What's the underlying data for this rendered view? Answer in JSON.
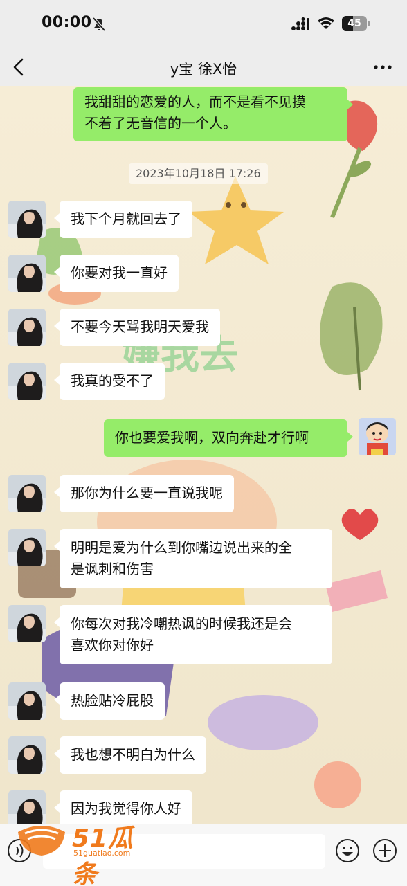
{
  "status_bar": {
    "time": "00:00",
    "battery": "45",
    "battery_level": 0.45
  },
  "header": {
    "title": "y宝 徐X怡"
  },
  "wallpaper": {
    "text": "嫌我去"
  },
  "messages": [
    {
      "side": "out",
      "lines": [
        "我甜甜的恋爱的人，而不是看不见摸",
        "不着了无音信的一个人。"
      ]
    },
    {
      "side": "in",
      "lines": [
        "我下个月就回去了"
      ]
    },
    {
      "side": "in",
      "lines": [
        "你要对我一直好"
      ]
    },
    {
      "side": "in",
      "lines": [
        "不要今天骂我明天爱我"
      ]
    },
    {
      "side": "in",
      "lines": [
        "我真的受不了"
      ]
    },
    {
      "side": "out",
      "lines": [
        "你也要爱我啊，双向奔赴才行啊"
      ]
    },
    {
      "side": "in",
      "lines": [
        "那你为什么要一直说我呢"
      ]
    },
    {
      "side": "in",
      "lines": [
        "明明是爱为什么到你嘴边说出来的全",
        "是讽刺和伤害"
      ]
    },
    {
      "side": "in",
      "lines": [
        "你每次对我冷嘲热讽的时候我还是会",
        "喜欢你对你好"
      ]
    },
    {
      "side": "in",
      "lines": [
        "热脸贴冷屁股"
      ]
    },
    {
      "side": "in",
      "lines": [
        "我也想不明白为什么"
      ]
    },
    {
      "side": "in",
      "lines": [
        "因为我觉得你人好"
      ]
    }
  ],
  "timestamp": "2023年10月18日 17:26",
  "watermark": {
    "brand": "51瓜条",
    "url": "51guatiao.com"
  },
  "icons": [
    "mute-icon",
    "signal-icon",
    "wifi-icon",
    "back-icon",
    "more-icon",
    "voice-icon",
    "emoji-icon",
    "plus-icon"
  ]
}
